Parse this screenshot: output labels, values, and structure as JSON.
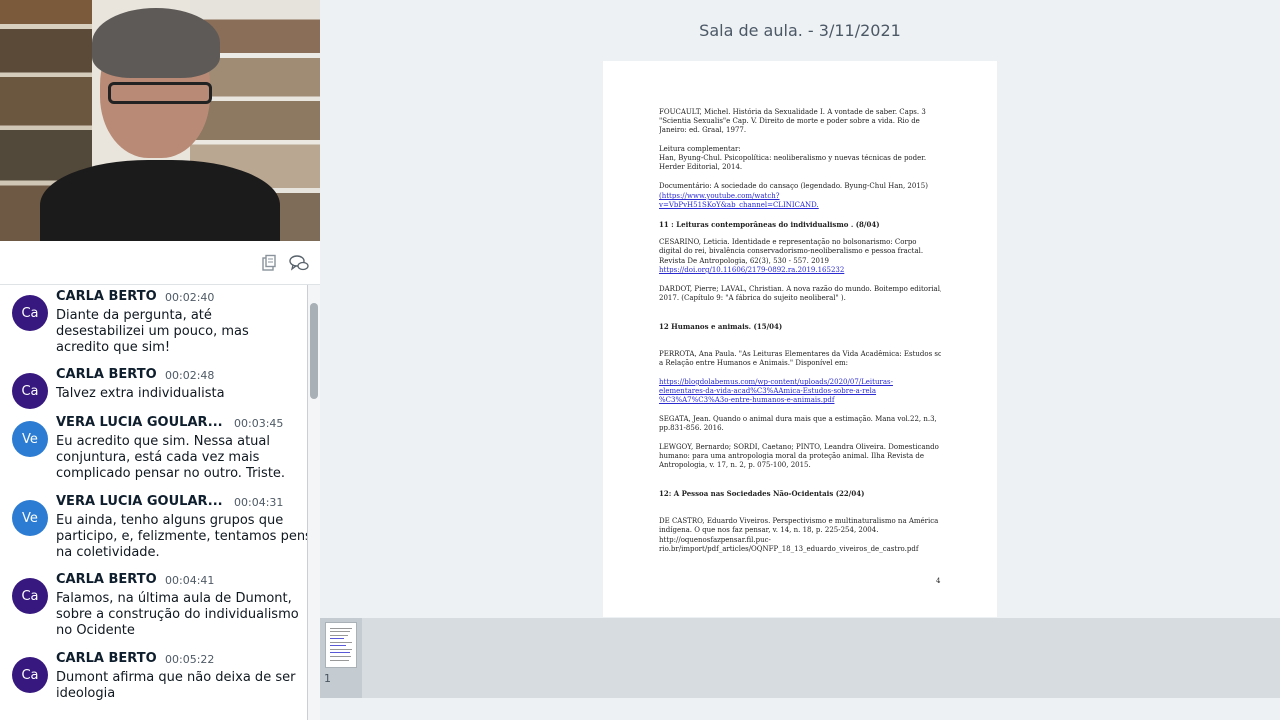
{
  "presentation": {
    "title": "Sala de aula. - 3/11/2021",
    "page_number": "4",
    "thumbnail_number": "1",
    "lines": [
      "FOUCAULT, Michel. História da Sexualidade I. A vontade de saber. Caps. 3",
      "\"Scientia Sexualis\"e Cap. V. Direito de morte e poder sobre a vida. Rio de",
      "Janeiro: ed. Graal, 1977.",
      "Leitura complementar:",
      "Han, Byung-Chul. Psicopolítica: neoliberalismo y nuevas técnicas de poder.",
      "Herder Editorial, 2014.",
      "Documentário: A sociedade do cansaço (legendado. Byung-Chul Han, 2015)",
      "(https://www.youtube.com/watch?",
      "v=VbPvH51SKoY&ab_channel=CLINICAND.",
      "11 : Leituras contemporâneas do individualismo . (8/04)",
      "CESARINO, Leticia. Identidade e representação no bolsonarismo: Corpo",
      "digital do rei, bivalência conservadorismo-neoliberalismo e pessoa fractal.",
      "Revista De Antropologia, 62(3), 530 - 557. 2019",
      "https://doi.org/10.11606/2179-0892.ra.2019.165232",
      "DARDOT, Pierre; LAVAL, Christian. A nova razão do mundo. Boitempo editorial,",
      "2017. (Capítulo 9: \"A fábrica do sujeito neoliberal\" ).",
      "12 Humanos e animais. (15/04)",
      "PERROTA, Ana Paula.  \"As Leituras Elementares da Vida Acadêmica: Estudos sobre",
      "a Relação entre Humanos e Animais.\" Disponível em:",
      "https://blogdolabemus.com/wp-content/uploads/2020/07/Leituras-",
      "elementares-da-vida-acad%C3%AAmica-Estudos-sobre-a-rela",
      "%C3%A7%C3%A3o-entre-humanos-e-animais.pdf",
      "SEGATA, Jean. Quando o animal dura mais que a estimação. Mana vol.22, n.3,",
      "pp.831-856. 2016.",
      "LEWGOY, Bernardo; SORDI, Caetano; PINTO, Leandra Oliveira. Domesticando o",
      "humano: para uma antropologia moral da proteção animal. Ilha Revista de",
      "Antropologia, v. 17, n. 2, p. 075-100, 2015.",
      "12: A Pessoa nas Sociedades Não-Ocidentais (22/04)",
      "DE CASTRO, Eduardo Viveiros. Perspectivismo e multinaturalismo na América",
      "indígena. O que nos faz pensar, v. 14, n. 18, p. 225-254, 2004.",
      "http://oquenosfazpensar.fil.puc-",
      "rio.br/import/pdf_articles/OQNFP_18_13_eduardo_viveiros_de_castro.pdf"
    ]
  },
  "chat": {
    "toolbar_icons": [
      "copy-icon",
      "chat-bubbles-icon"
    ],
    "messages": [
      {
        "initials": "Ca",
        "name": "CARLA BERTO",
        "time": "00:02:40",
        "lines": [
          "Diante da pergunta, até",
          "desestabilizei um pouco, mas",
          "acredito que sim!"
        ]
      },
      {
        "initials": "Ca",
        "name": "CARLA BERTO",
        "time": "00:02:48",
        "lines": [
          "Talvez extra individualista"
        ]
      },
      {
        "initials": "Ve",
        "name": "VERA LUCIA GOULAR...",
        "time": "00:03:45",
        "lines": [
          "Eu acredito que sim. Nessa atual",
          "conjuntura, está cada vez mais",
          "complicado pensar no outro. Triste."
        ]
      },
      {
        "initials": "Ve",
        "name": "VERA LUCIA GOULAR...",
        "time": "00:04:31",
        "lines": [
          "Eu ainda, tenho alguns grupos que",
          "participo, e, felizmente, tentamos pens",
          "na coletividade."
        ]
      },
      {
        "initials": "Ca",
        "name": "CARLA BERTO",
        "time": "00:04:41",
        "lines": [
          "Falamos, na última aula de Dumont,",
          "sobre a construção do individualismo",
          "no Ocidente"
        ]
      },
      {
        "initials": "Ca",
        "name": "CARLA BERTO",
        "time": "00:05:22",
        "lines": [
          "Dumont afirma que não deixa de ser",
          "ideologia"
        ]
      }
    ]
  },
  "colors": {
    "avatar_carla": "#37187f",
    "avatar_vera": "#2c7cd3",
    "link": "#2a2ad0"
  }
}
